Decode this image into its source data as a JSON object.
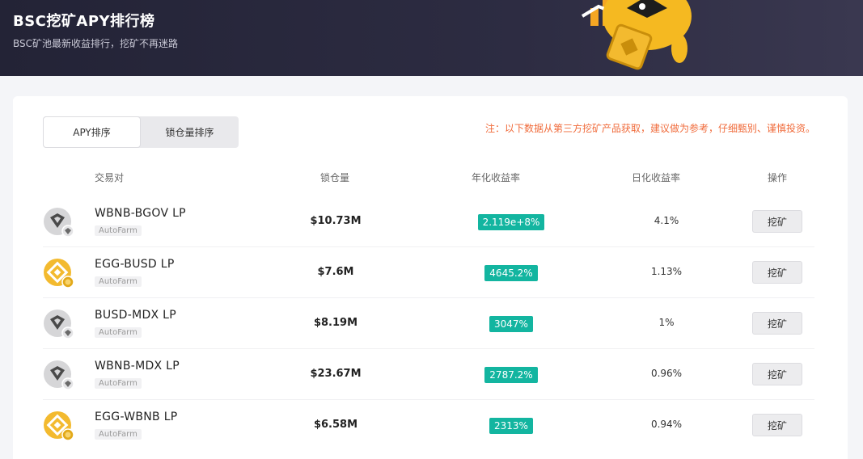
{
  "banner": {
    "title": "BSC挖矿APY排行榜",
    "subtitle": "BSC矿池最新收益排行，挖矿不再迷路"
  },
  "tabs": [
    {
      "label": "APY排序",
      "active": true
    },
    {
      "label": "锁仓量排序",
      "active": false
    }
  ],
  "notice": "注：以下数据从第三方挖矿产品获取，建议做为参考，仔细甄别、谨慎投资。",
  "table": {
    "headers": {
      "pair": "交易对",
      "tvl": "锁仓量",
      "apy": "年化收益率",
      "daily": "日化收益率",
      "action": "操作"
    },
    "rows": [
      {
        "pair": "WBNB-BGOV LP",
        "platform": "AutoFarm",
        "tvl": "$10.73M",
        "apy": "2.119e+8%",
        "daily": "4.1%",
        "action": "挖矿",
        "icon": "gray-token-icon"
      },
      {
        "pair": "EGG-BUSD LP",
        "platform": "AutoFarm",
        "tvl": "$7.6M",
        "apy": "4645.2%",
        "daily": "1.13%",
        "action": "挖矿",
        "icon": "yellow-token-icon"
      },
      {
        "pair": "BUSD-MDX LP",
        "platform": "AutoFarm",
        "tvl": "$8.19M",
        "apy": "3047%",
        "daily": "1%",
        "action": "挖矿",
        "icon": "gray-token-icon"
      },
      {
        "pair": "WBNB-MDX LP",
        "platform": "AutoFarm",
        "tvl": "$23.67M",
        "apy": "2787.2%",
        "daily": "0.96%",
        "action": "挖矿",
        "icon": "gray-token-icon"
      },
      {
        "pair": "EGG-WBNB LP",
        "platform": "AutoFarm",
        "tvl": "$6.58M",
        "apy": "2313%",
        "daily": "0.94%",
        "action": "挖矿",
        "icon": "yellow-token-icon"
      }
    ]
  },
  "colors": {
    "banner_bg": "#262638",
    "apy_badge": "#13b5a0",
    "notice": "#f06b3b"
  }
}
